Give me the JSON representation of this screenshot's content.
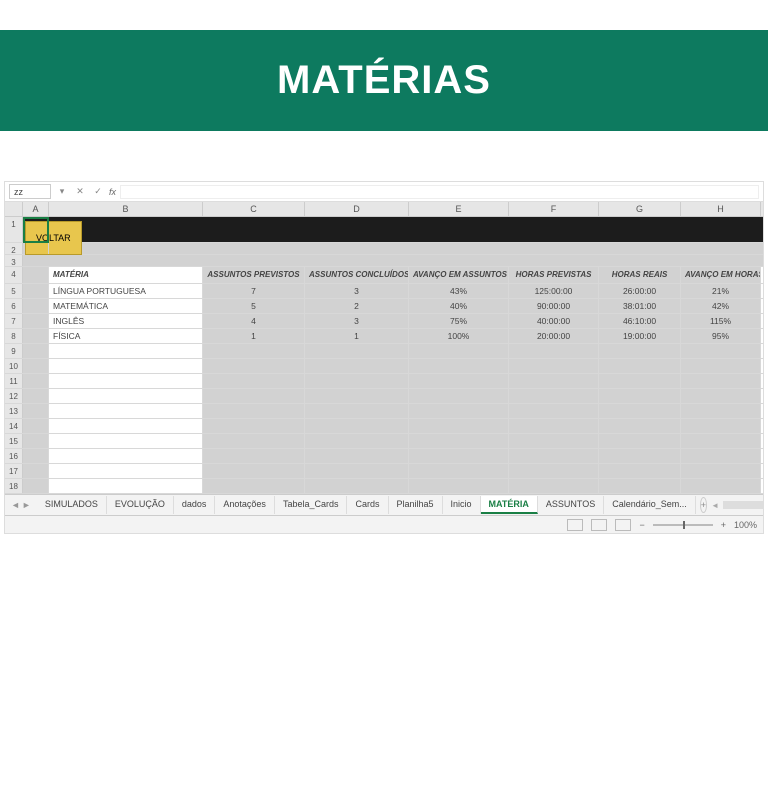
{
  "banner": {
    "title": "MATÉRIAS"
  },
  "namebox": "zz",
  "voltar": "VOLTAR",
  "columns": [
    "A",
    "B",
    "C",
    "D",
    "E",
    "F",
    "G",
    "H"
  ],
  "headers": {
    "materia": "MATÉRIA",
    "assuntos_previstos": "ASSUNTOS PREVISTOS",
    "assuntos_concluidos": "ASSUNTOS CONCLUÍDOS",
    "avanco_assuntos": "AVANÇO EM ASSUNTOS",
    "horas_previstas": "HORAS PREVISTAS",
    "horas_reais": "HORAS REAIS",
    "avanco_horas": "AVANÇO EM HORAS"
  },
  "rows": [
    {
      "materia": "LÍNGUA PORTUGUESA",
      "ap": "7",
      "ac": "3",
      "aa": "43%",
      "hp": "125:00:00",
      "hr": "26:00:00",
      "ah": "21%"
    },
    {
      "materia": "MATEMÁTICA",
      "ap": "5",
      "ac": "2",
      "aa": "40%",
      "hp": "90:00:00",
      "hr": "38:01:00",
      "ah": "42%"
    },
    {
      "materia": "INGLÊS",
      "ap": "4",
      "ac": "3",
      "aa": "75%",
      "hp": "40:00:00",
      "hr": "46:10:00",
      "ah": "115%"
    },
    {
      "materia": "FÍSICA",
      "ap": "1",
      "ac": "1",
      "aa": "100%",
      "hp": "20:00:00",
      "hr": "19:00:00",
      "ah": "95%"
    }
  ],
  "rownums_start": 1,
  "empty_rows": [
    9,
    10,
    11,
    12,
    13,
    14,
    15,
    16,
    17,
    18
  ],
  "tabs": [
    "SIMULADOS",
    "EVOLUÇÃO",
    "dados",
    "Anotações",
    "Tabela_Cards",
    "Cards",
    "Planilha5",
    "Inicio",
    "MATÉRIA",
    "ASSUNTOS",
    "Calendário_Sem..."
  ],
  "active_tab": "MATÉRIA",
  "zoom": "100%"
}
